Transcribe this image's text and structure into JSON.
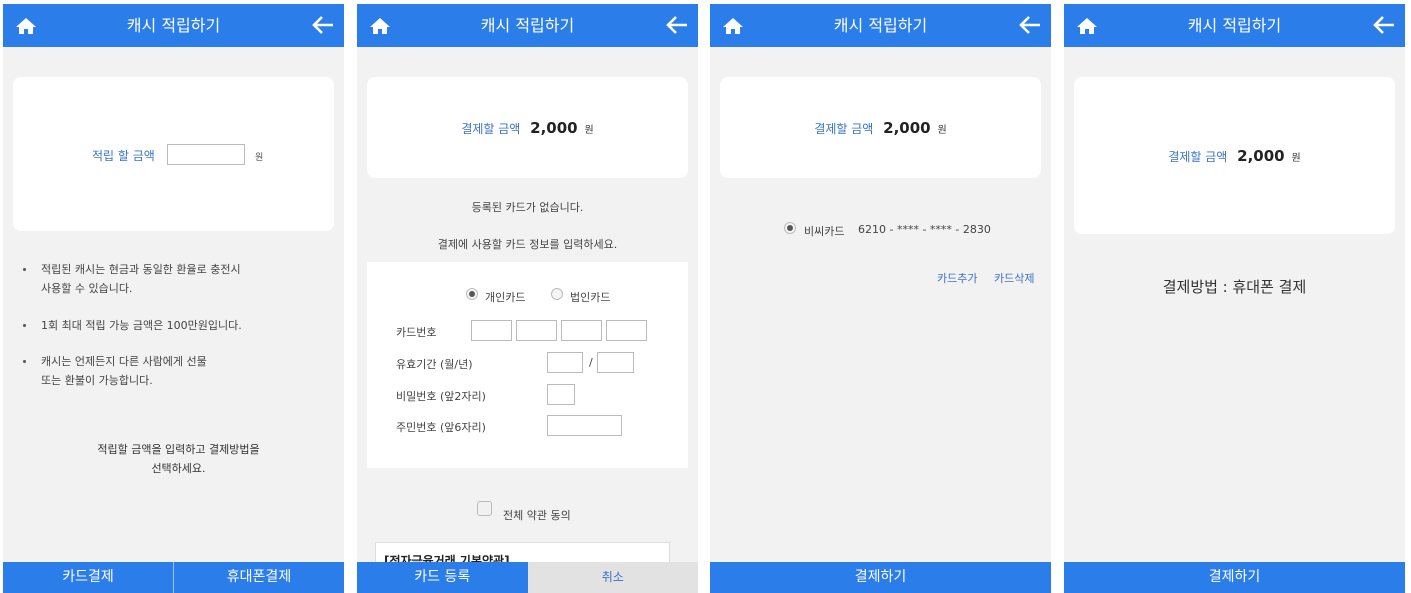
{
  "header": {
    "title": "캐시 적립하기",
    "home_icon": "home-icon",
    "back_icon": "arrow-left-icon"
  },
  "colors": {
    "accent": "#2b7de9",
    "link": "#3a72c9"
  },
  "screen1": {
    "amount_label": "적립 할 금액",
    "amount_value": "",
    "unit": "원",
    "notes": [
      "적립된 캐시는 현금과 동일한 환율로 충전시\n사용할 수 있습니다.",
      "1회 최대 적립 가능 금액은 100만원입니다.",
      "캐시는 언제든지 다른 사람에게 선물\n또는 환불이 가능합니다."
    ],
    "instruction": "적립할 금액을 입력하고 결제방법을\n선택하세요.",
    "btn_card": "카드결제",
    "btn_phone": "휴대폰결제"
  },
  "screen2": {
    "pay_label": "결제할 금액",
    "pay_amount": "2,000",
    "unit": "원",
    "no_card": "등록된 카드가 없습니다.",
    "enter_card": "결제에 사용할 카드 정보를 입력하세요.",
    "radio_personal": "개인카드",
    "radio_corporate": "법인카드",
    "card_number_label": "카드번호",
    "expiry_label": "유효기간 (월/년)",
    "expiry_sep": "/",
    "password_label": "비밀번호 (앞2자리)",
    "resident_label": "주민번호 (앞6자리)",
    "agree_label": "전체 약관 동의",
    "terms_title": "[전자금융거래 기본약관]",
    "btn_register": "카드 등록",
    "btn_cancel": "취소"
  },
  "screen3": {
    "pay_label": "결제할 금액",
    "pay_amount": "2,000",
    "unit": "원",
    "card_name": "비씨카드",
    "card_number": "6210 - **** - **** - 2830",
    "add_card": "카드추가",
    "delete_card": "카드삭제",
    "btn_pay": "결제하기"
  },
  "screen4": {
    "pay_label": "결제할 금액",
    "pay_amount": "2,000",
    "unit": "원",
    "method": "결제방법 : 휴대폰 결제",
    "btn_pay": "결제하기"
  }
}
